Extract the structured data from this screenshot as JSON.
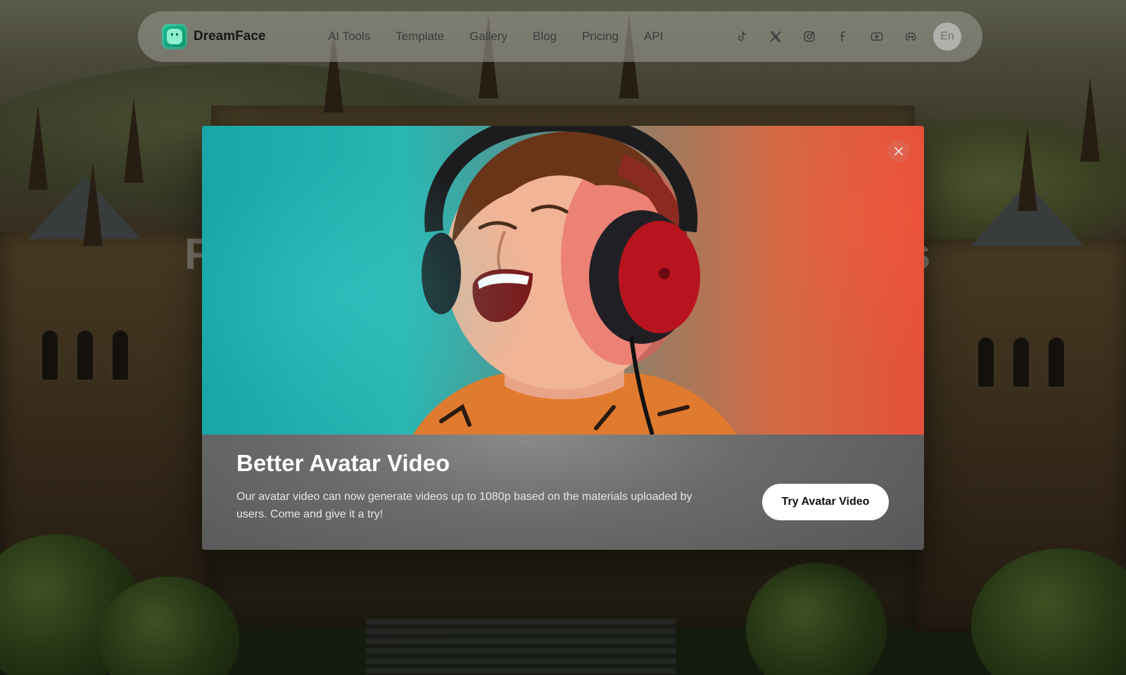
{
  "nav": {
    "brand": "DreamFace",
    "menu": [
      "AI Tools",
      "Template",
      "Gallery",
      "Blog",
      "Pricing",
      "API"
    ],
    "socials": [
      "tiktok-icon",
      "x-icon",
      "instagram-icon",
      "facebook-icon",
      "youtube-icon",
      "discord-icon"
    ],
    "language": "En"
  },
  "hero": {
    "visible_left": "F",
    "visible_right": "s"
  },
  "modal": {
    "title": "Better Avatar Video",
    "description": "Our avatar video can now generate videos up to 1080p based on the materials uploaded by users. Come and give it a try!",
    "cta": "Try Avatar Video",
    "close_icon": "close-icon"
  },
  "colors": {
    "brand": "#15b98c",
    "modal_background": "#6b6b6b",
    "cta_background": "#ffffff"
  }
}
